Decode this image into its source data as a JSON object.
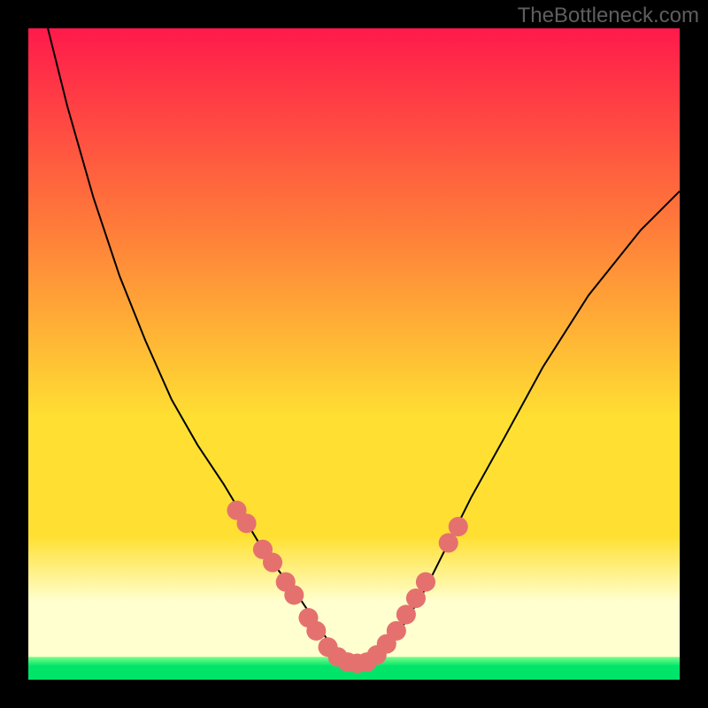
{
  "watermark": "TheBottleneck.com",
  "colors": {
    "background_frame": "#000000",
    "gradient_top": "#ff1a4b",
    "gradient_mid_orange": "#ff7a3a",
    "gradient_yellow": "#ffe032",
    "gradient_pale": "#ffffcf",
    "green_edge": "#7bff8b",
    "green_core": "#00e46a",
    "curve_stroke": "#000000",
    "dot_fill": "#e5716f"
  },
  "chart_data": {
    "type": "line",
    "title": "",
    "xlabel": "",
    "ylabel": "",
    "xlim": [
      0,
      100
    ],
    "ylim": [
      0,
      100
    ],
    "grid": false,
    "legend": false,
    "note": "Axis units are percent of inner plot area; y increases downward (screen space). The curve is a single V-shaped bottleneck profile.",
    "series": [
      {
        "name": "bottleneck-curve",
        "x": [
          3,
          6,
          10,
          14,
          18,
          22,
          26,
          30,
          33,
          36,
          39,
          42,
          44,
          46,
          48,
          50,
          52,
          54,
          56,
          58,
          61,
          64,
          68,
          73,
          79,
          86,
          94,
          100
        ],
        "y": [
          0,
          12,
          26,
          38,
          48,
          57,
          64,
          70,
          75,
          80,
          84,
          88,
          91,
          94,
          96.5,
          97.5,
          97.5,
          96.5,
          94,
          91,
          86,
          80,
          72,
          63,
          52,
          41,
          31,
          25
        ]
      }
    ],
    "dots": {
      "name": "highlight-dots",
      "note": "Salmon circular markers clustered near the bottom of the V.",
      "points": [
        {
          "x": 32.0,
          "y": 74.0
        },
        {
          "x": 33.5,
          "y": 76.0
        },
        {
          "x": 36.0,
          "y": 80.0
        },
        {
          "x": 37.5,
          "y": 82.0
        },
        {
          "x": 39.5,
          "y": 85.0
        },
        {
          "x": 40.8,
          "y": 87.0
        },
        {
          "x": 43.0,
          "y": 90.5
        },
        {
          "x": 44.2,
          "y": 92.5
        },
        {
          "x": 46.0,
          "y": 95.0
        },
        {
          "x": 47.5,
          "y": 96.5
        },
        {
          "x": 49.0,
          "y": 97.3
        },
        {
          "x": 50.5,
          "y": 97.5
        },
        {
          "x": 52.0,
          "y": 97.3
        },
        {
          "x": 53.5,
          "y": 96.2
        },
        {
          "x": 55.0,
          "y": 94.5
        },
        {
          "x": 56.5,
          "y": 92.5
        },
        {
          "x": 58.0,
          "y": 90.0
        },
        {
          "x": 59.5,
          "y": 87.5
        },
        {
          "x": 61.0,
          "y": 85.0
        },
        {
          "x": 64.5,
          "y": 79.0
        },
        {
          "x": 66.0,
          "y": 76.5
        }
      ],
      "radius_pct": 1.5
    },
    "green_band": {
      "top_pct": 96.5,
      "bottom_pct": 100
    },
    "pale_band": {
      "top_pct": 78,
      "bottom_pct": 96.5
    }
  }
}
